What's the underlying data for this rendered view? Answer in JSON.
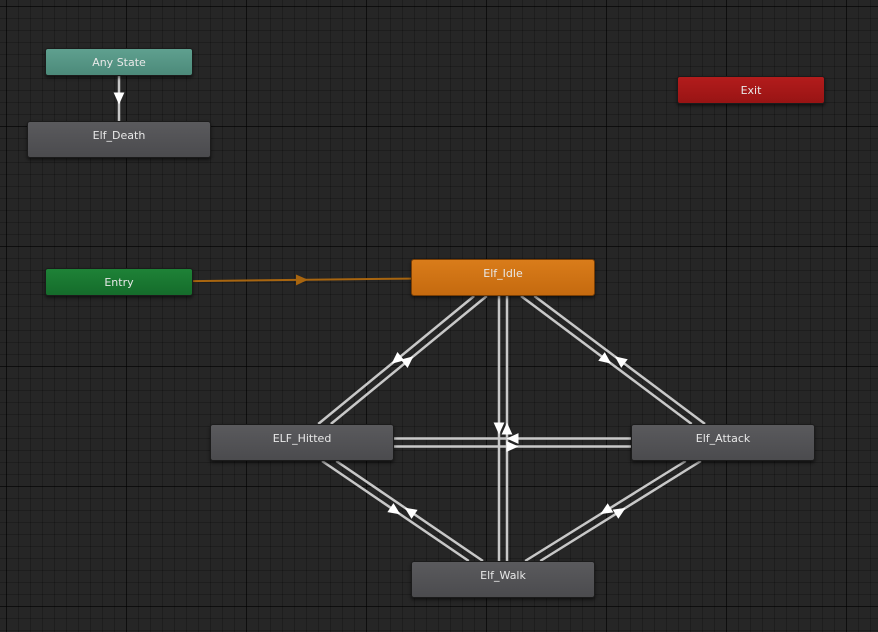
{
  "states": {
    "any_state": "Any State",
    "death": "Elf_Death",
    "entry": "Entry",
    "exit": "Exit",
    "idle": "Elf_Idle",
    "hitted": "ELF_Hitted",
    "attack": "Elf_Attack",
    "walk": "Elf_Walk"
  },
  "transitions": [
    {
      "from": "any_state",
      "to": "death"
    },
    {
      "from": "entry",
      "to": "idle"
    },
    {
      "from": "idle",
      "to": "hitted"
    },
    {
      "from": "hitted",
      "to": "idle"
    },
    {
      "from": "idle",
      "to": "attack"
    },
    {
      "from": "attack",
      "to": "idle"
    },
    {
      "from": "idle",
      "to": "walk"
    },
    {
      "from": "walk",
      "to": "idle"
    },
    {
      "from": "hitted",
      "to": "attack"
    },
    {
      "from": "attack",
      "to": "hitted"
    },
    {
      "from": "hitted",
      "to": "walk"
    },
    {
      "from": "walk",
      "to": "hitted"
    },
    {
      "from": "attack",
      "to": "walk"
    },
    {
      "from": "walk",
      "to": "attack"
    }
  ],
  "colors": {
    "transition": "#c8c8c8",
    "entry_transition": "#a8650f",
    "default_state": "#d97c1a",
    "any_state": "#5fa08f",
    "entry": "#1e8237",
    "exit": "#b31c1c"
  }
}
